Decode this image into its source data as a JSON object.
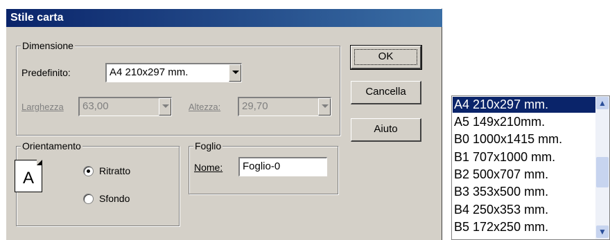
{
  "dialog": {
    "title": "Stile carta",
    "dimensione": {
      "legend": "Dimensione",
      "predefinito_label": "Predefinito:",
      "predefinito_value": "A4 210x297 mm.",
      "larghezza_label": "Larghezza",
      "larghezza_value": "63,00",
      "altezza_label": "Altezza:",
      "altezza_value": "29,70"
    },
    "orientamento": {
      "legend": "Orientamento",
      "paper_letter": "A",
      "ritratto_label": "Ritratto",
      "sfondo_label": "Sfondo",
      "selected": "Ritratto"
    },
    "foglio": {
      "legend": "Foglio",
      "nome_label": "Nome:",
      "nome_value": "Foglio-0"
    },
    "buttons": {
      "ok": "OK",
      "cancella": "Cancella",
      "aiuto": "Aiuto"
    }
  },
  "size_list": {
    "items": [
      "A4 210x297 mm.",
      "A5 149x210mm.",
      "B0 1000x1415 mm.",
      "B1 707x1000 mm.",
      "B2 500x707 mm.",
      "B3 353x500 mm.",
      "B4 250x353 mm.",
      "B5 172x250 mm."
    ],
    "selected_index": 0
  },
  "colors": {
    "title_bar": "#0a246a",
    "dialog_face": "#d4d0c8",
    "selection": "#0a246a"
  }
}
